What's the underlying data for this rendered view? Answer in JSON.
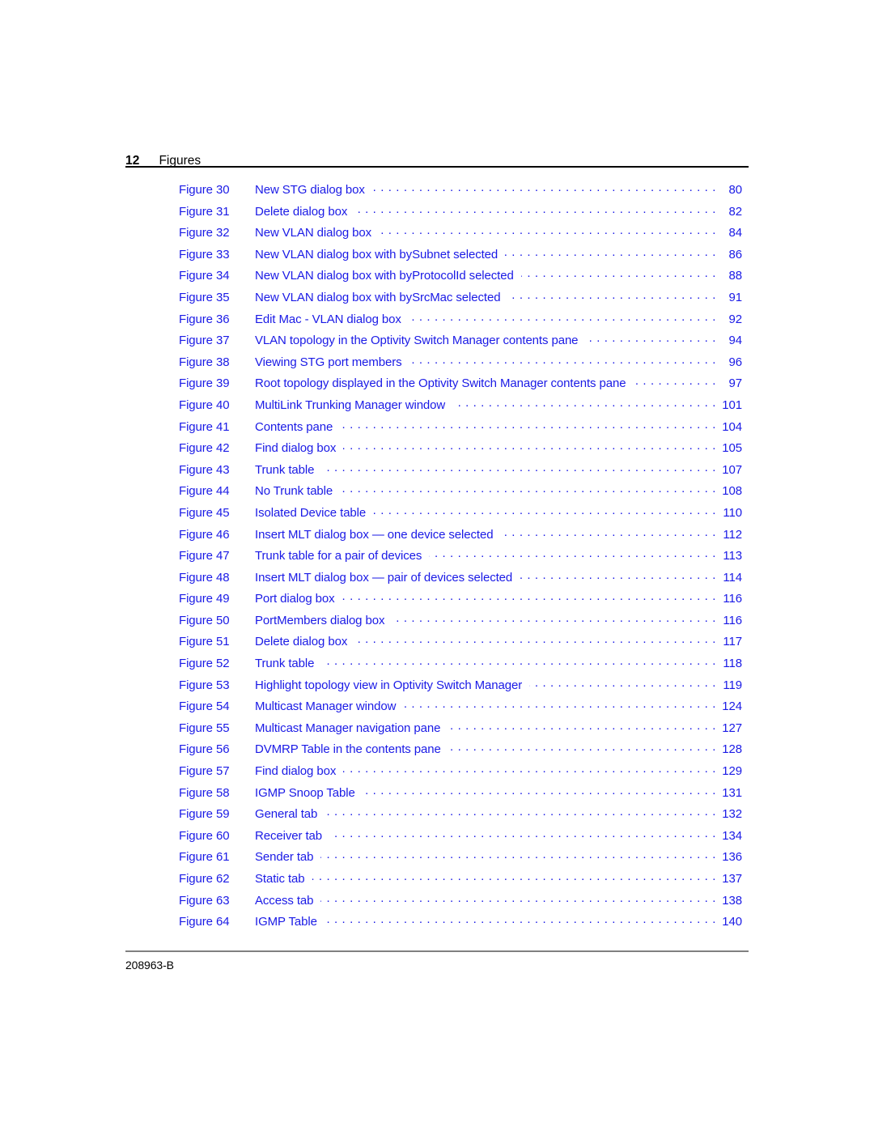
{
  "document": {
    "header": {
      "page_number": "12",
      "section_title": "Figures"
    },
    "footer": {
      "document_id": "208963-B"
    },
    "colors": {
      "entry_blue": "#1a1ae6",
      "header_text": "#000000",
      "header_rule": "#000000",
      "footer_rule": "#808080"
    },
    "figures": [
      {
        "label": "Figure 30",
        "title": "New STG dialog box",
        "page": "80"
      },
      {
        "label": "Figure 31",
        "title": "Delete dialog box",
        "page": "82"
      },
      {
        "label": "Figure 32",
        "title": "New VLAN dialog box",
        "page": "84"
      },
      {
        "label": "Figure 33",
        "title": "New VLAN dialog box with bySubnet selected",
        "page": "86"
      },
      {
        "label": "Figure 34",
        "title": "New VLAN dialog box with byProtocolId selected",
        "page": "88"
      },
      {
        "label": "Figure 35",
        "title": "New VLAN dialog box with bySrcMac selected",
        "page": "91"
      },
      {
        "label": "Figure 36",
        "title": "Edit Mac - VLAN dialog box",
        "page": "92"
      },
      {
        "label": "Figure 37",
        "title": "VLAN topology in the Optivity Switch Manager contents pane",
        "page": "94"
      },
      {
        "label": "Figure 38",
        "title": "Viewing STG port members",
        "page": "96"
      },
      {
        "label": "Figure 39",
        "title": "Root topology displayed in the Optivity Switch Manager contents pane",
        "page": "97"
      },
      {
        "label": "Figure 40",
        "title": "MultiLink Trunking Manager window",
        "page": "101"
      },
      {
        "label": "Figure 41",
        "title": "Contents pane",
        "page": "104"
      },
      {
        "label": "Figure 42",
        "title": "Find dialog box",
        "page": "105"
      },
      {
        "label": "Figure 43",
        "title": "Trunk table",
        "page": "107"
      },
      {
        "label": "Figure 44",
        "title": "No Trunk table",
        "page": "108"
      },
      {
        "label": "Figure 45",
        "title": "Isolated Device table",
        "page": "110"
      },
      {
        "label": "Figure 46",
        "title": "Insert MLT dialog box — one device selected",
        "page": "112"
      },
      {
        "label": "Figure 47",
        "title": "Trunk table for a pair of devices",
        "page": "113"
      },
      {
        "label": "Figure 48",
        "title": "Insert MLT dialog box — pair of devices selected",
        "page": "114"
      },
      {
        "label": "Figure 49",
        "title": "Port dialog box",
        "page": "116"
      },
      {
        "label": "Figure 50",
        "title": "PortMembers dialog box",
        "page": "116"
      },
      {
        "label": "Figure 51",
        "title": "Delete dialog box",
        "page": "117"
      },
      {
        "label": "Figure 52",
        "title": "Trunk table",
        "page": "118"
      },
      {
        "label": "Figure 53",
        "title": "Highlight topology view in Optivity Switch Manager",
        "page": "119"
      },
      {
        "label": "Figure 54",
        "title": "Multicast Manager window",
        "page": "124"
      },
      {
        "label": "Figure 55",
        "title": "Multicast Manager navigation pane",
        "page": "127"
      },
      {
        "label": "Figure 56",
        "title": "DVMRP Table in the contents pane",
        "page": "128"
      },
      {
        "label": "Figure 57",
        "title": "Find dialog box",
        "page": "129"
      },
      {
        "label": "Figure 58",
        "title": "IGMP Snoop Table",
        "page": "131"
      },
      {
        "label": "Figure 59",
        "title": "General tab",
        "page": "132"
      },
      {
        "label": "Figure 60",
        "title": "Receiver tab",
        "page": "134"
      },
      {
        "label": "Figure 61",
        "title": "Sender tab",
        "page": "136"
      },
      {
        "label": "Figure 62",
        "title": "Static tab",
        "page": "137"
      },
      {
        "label": "Figure 63",
        "title": "Access tab",
        "page": "138"
      },
      {
        "label": "Figure 64",
        "title": "IGMP Table",
        "page": "140"
      }
    ]
  }
}
